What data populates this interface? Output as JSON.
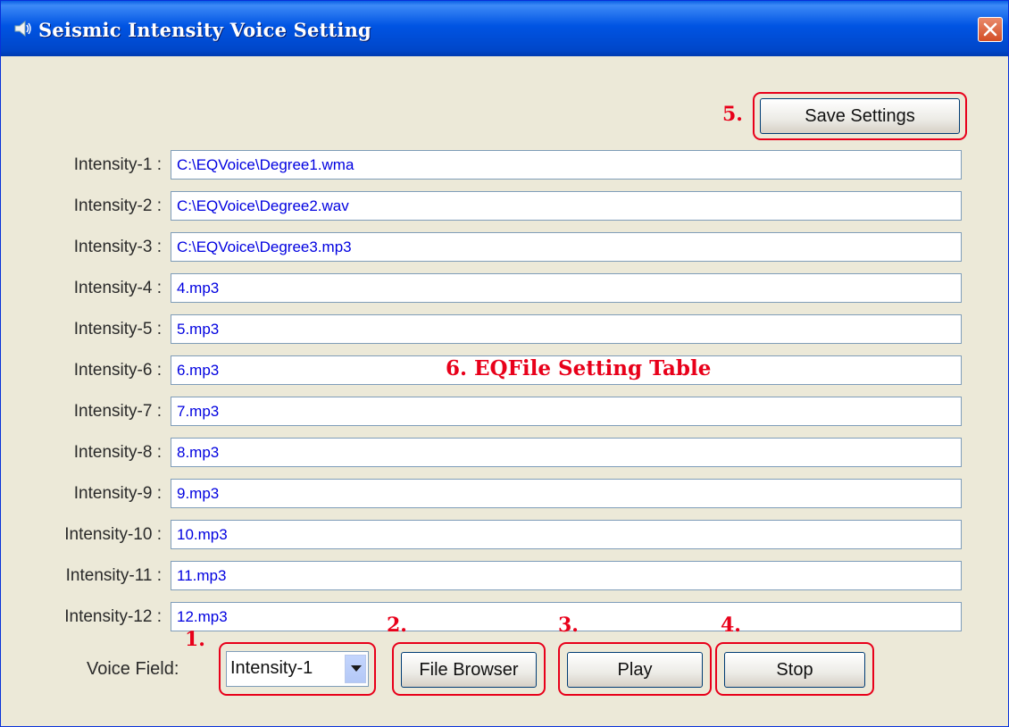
{
  "window": {
    "title": "Seismic Intensity Voice Setting"
  },
  "save_button": "Save Settings",
  "intensities": [
    {
      "label": "Intensity-1 :",
      "value": "C:\\EQVoice\\Degree1.wma"
    },
    {
      "label": "Intensity-2 :",
      "value": "C:\\EQVoice\\Degree2.wav"
    },
    {
      "label": "Intensity-3 :",
      "value": "C:\\EQVoice\\Degree3.mp3"
    },
    {
      "label": "Intensity-4 :",
      "value": "4.mp3"
    },
    {
      "label": "Intensity-5 :",
      "value": "5.mp3"
    },
    {
      "label": "Intensity-6 :",
      "value": "6.mp3"
    },
    {
      "label": "Intensity-7 :",
      "value": "7.mp3"
    },
    {
      "label": "Intensity-8 :",
      "value": "8.mp3"
    },
    {
      "label": "Intensity-9 :",
      "value": "9.mp3"
    },
    {
      "label": "Intensity-10 :",
      "value": "10.mp3"
    },
    {
      "label": "Intensity-11 :",
      "value": "11.mp3"
    },
    {
      "label": "Intensity-12 :",
      "value": "12.mp3"
    }
  ],
  "voice_field": {
    "label": "Voice Field:",
    "selected": "Intensity-1"
  },
  "buttons": {
    "file_browser": "File Browser",
    "play": "Play",
    "stop": "Stop"
  },
  "annotations": {
    "n1": "1.",
    "n2": "2.",
    "n3": "3.",
    "n4": "4.",
    "n5": "5.",
    "table": "6. EQFile Setting Table"
  },
  "colors": {
    "annotation": "#e8001a",
    "field_text": "#0000e0",
    "titlebar": "#0054e3"
  }
}
